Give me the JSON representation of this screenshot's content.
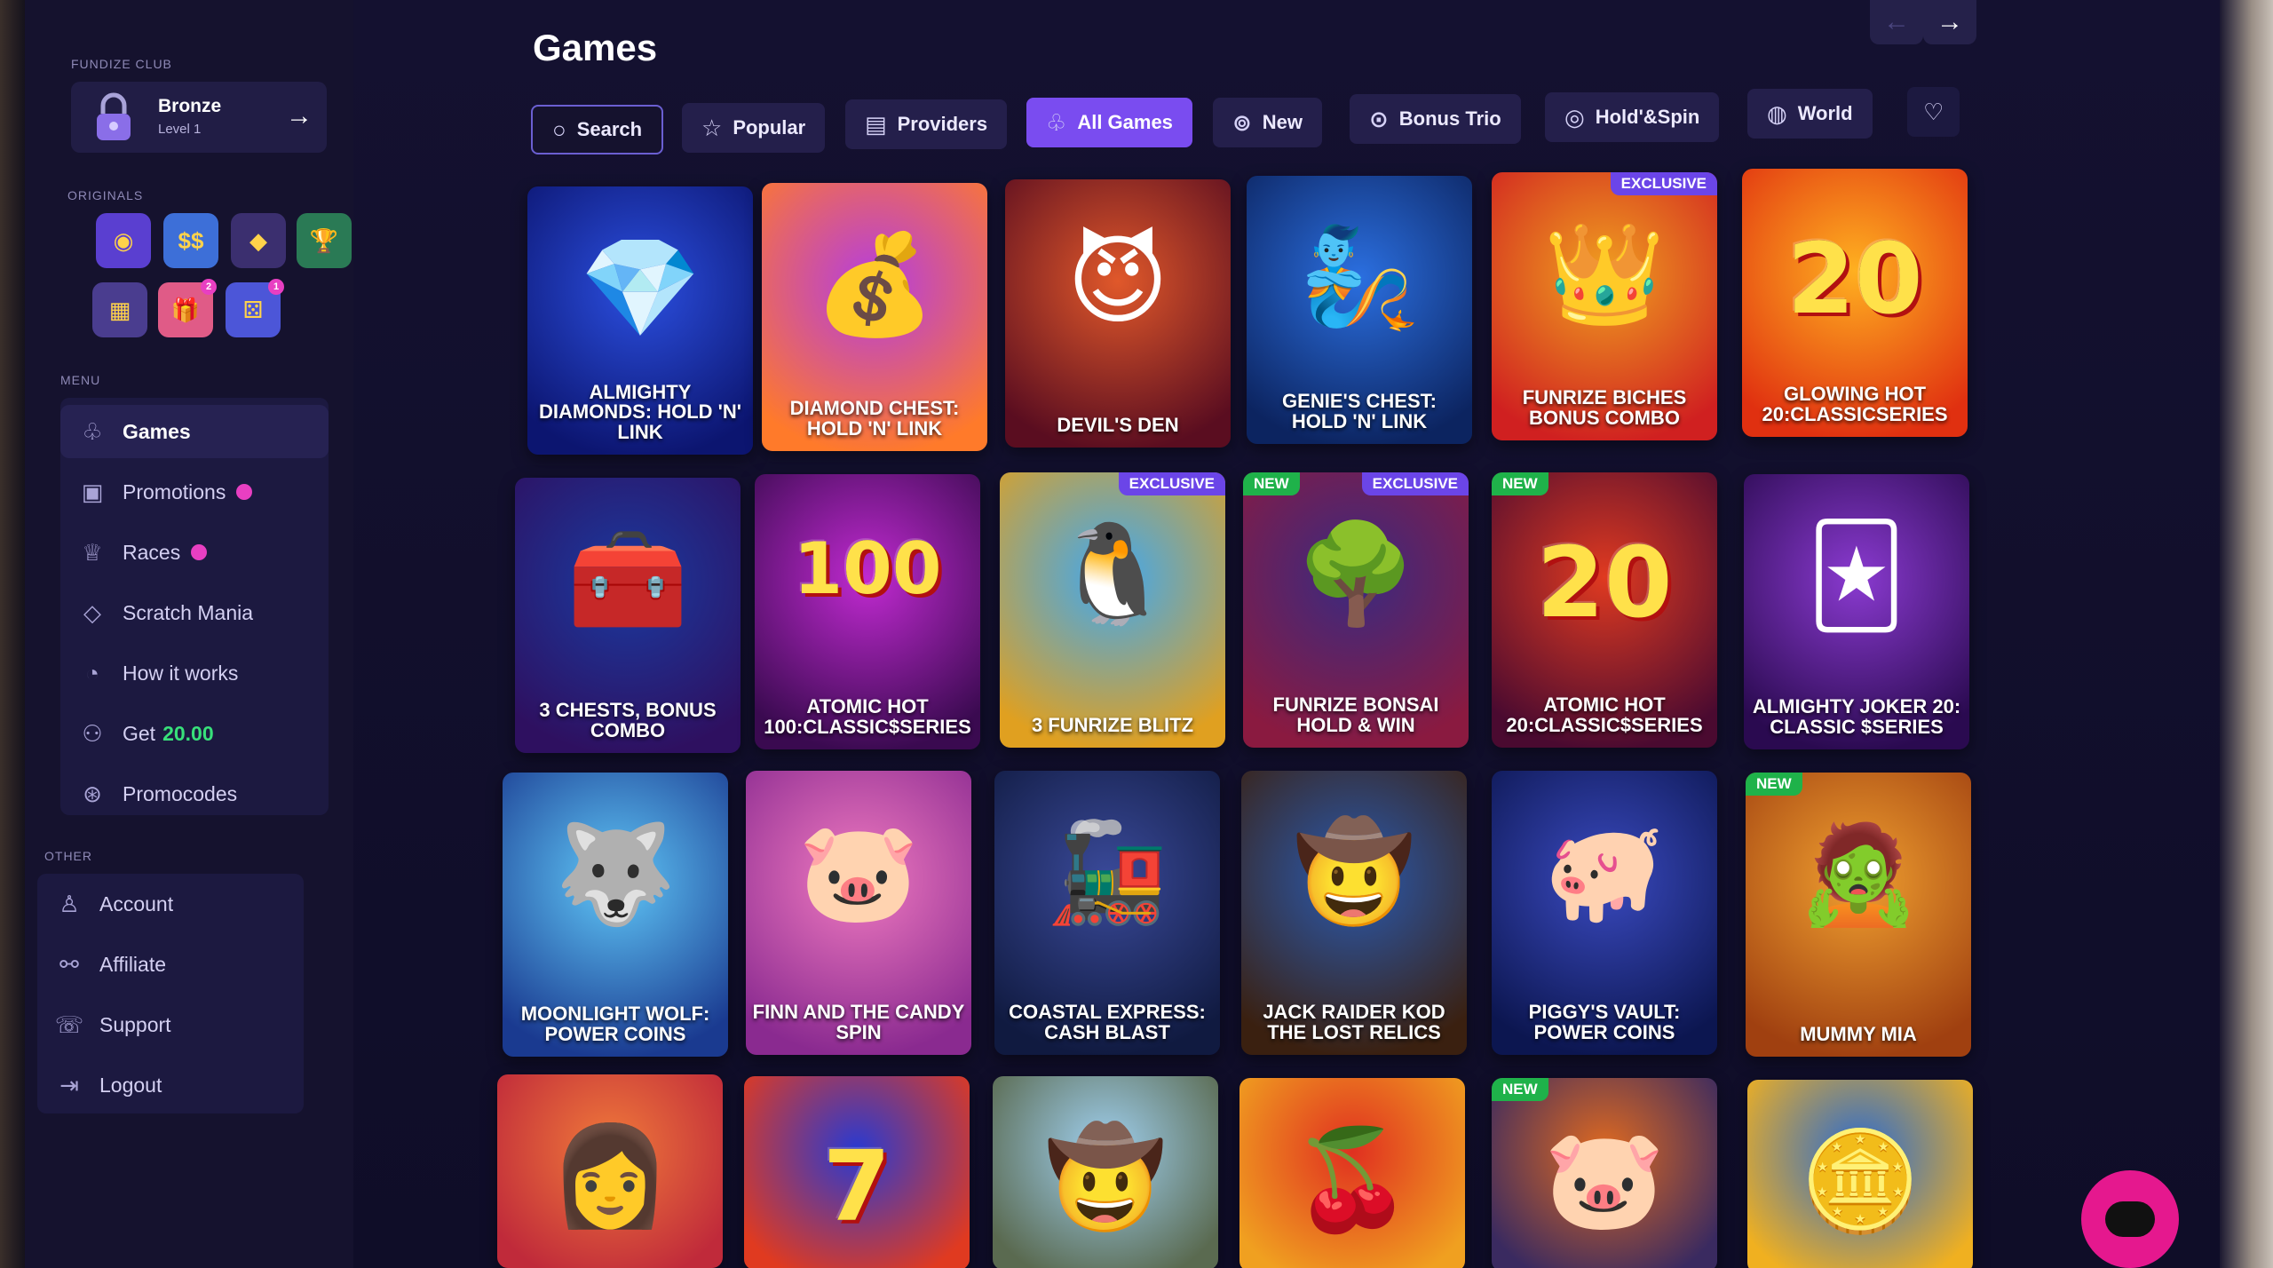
{
  "club": {
    "section": "FUNDIZE CLUB",
    "name": "Bronze",
    "level": "Level 1"
  },
  "originals": {
    "section": "ORIGINALS",
    "items": [
      {
        "icon": "wheel-icon",
        "color": "#5a3fd0",
        "glyph": "◉",
        "badge": ""
      },
      {
        "icon": "cash-stack-icon",
        "color": "#3d6fd8",
        "glyph": "$$",
        "badge": ""
      },
      {
        "icon": "gold-bar-icon",
        "color": "#3b2f6f",
        "glyph": "◆",
        "badge": ""
      },
      {
        "icon": "trophy-icon",
        "color": "#2a7a55",
        "glyph": "🏆",
        "badge": ""
      },
      {
        "icon": "grid-box-icon",
        "color": "#4a3d8f",
        "glyph": "▦",
        "badge": ""
      },
      {
        "icon": "gift-box-icon",
        "color": "#e05b87",
        "glyph": "🎁",
        "badge": "2"
      },
      {
        "icon": "dice-icon",
        "color": "#4c56d8",
        "glyph": "⚄",
        "badge": "1"
      }
    ]
  },
  "menu": {
    "section": "MENU",
    "items": [
      {
        "label": "Games",
        "icon": "games-icon",
        "glyph": "♧",
        "badge": false,
        "active": true
      },
      {
        "label": "Promotions",
        "icon": "gift-icon",
        "glyph": "▣",
        "badge": true
      },
      {
        "label": "Races",
        "icon": "trophy-outline-icon",
        "glyph": "♕",
        "badge": true
      },
      {
        "label": "Scratch Mania",
        "icon": "ticket-icon",
        "glyph": "◇",
        "badge": false
      },
      {
        "label": "How it works",
        "icon": "clock-icon",
        "glyph": "◔",
        "badge": false
      },
      {
        "label": "Get",
        "icon": "referral-icon",
        "glyph": "⚇",
        "badge": false,
        "amount": "20.00"
      },
      {
        "label": "Promocodes",
        "icon": "coupon-icon",
        "glyph": "⊛",
        "badge": false
      }
    ]
  },
  "other": {
    "section": "OTHER",
    "items": [
      {
        "label": "Account",
        "icon": "user-icon",
        "glyph": "♙"
      },
      {
        "label": "Affiliate",
        "icon": "handshake-icon",
        "glyph": "⚯"
      },
      {
        "label": "Support",
        "icon": "support-icon",
        "glyph": "☏"
      },
      {
        "label": "Logout",
        "icon": "logout-icon",
        "glyph": "⇥"
      }
    ]
  },
  "page": {
    "title": "Games"
  },
  "filters": [
    {
      "label": "Search",
      "icon": "search-icon",
      "glyph": "○",
      "kind": "search"
    },
    {
      "label": "Popular",
      "icon": "star-icon",
      "glyph": "☆"
    },
    {
      "label": "Providers",
      "icon": "providers-icon",
      "glyph": "▤"
    },
    {
      "label": "All Games",
      "icon": "all-games-icon",
      "glyph": "♧",
      "kind": "active"
    },
    {
      "label": "New",
      "icon": "new-icon",
      "glyph": "⊚"
    },
    {
      "label": "Bonus Trio",
      "icon": "bonus-trio-icon",
      "glyph": "⊙"
    },
    {
      "label": "Hold'&Spin",
      "icon": "hold-spin-icon",
      "glyph": "◎"
    },
    {
      "label": "World",
      "icon": "globe-icon",
      "glyph": "◍"
    },
    {
      "label": "",
      "icon": "heart-icon",
      "glyph": "♡"
    }
  ],
  "games": [
    [
      {
        "title": "ALMIGHTY DIAMONDS: HOLD 'N' LINK",
        "bg": [
          "#2b4fe0",
          "#0c1570"
        ],
        "glyph": "💎",
        "tag": ""
      },
      {
        "title": "DIAMOND CHEST: HOLD 'N' LINK",
        "bg": [
          "#b43de0",
          "#ff7a2a"
        ],
        "glyph": "💰",
        "tag": ""
      },
      {
        "title": "DEVIL'S DEN",
        "bg": [
          "#e0582a",
          "#5a0d20"
        ],
        "glyph": "😈",
        "tag": ""
      },
      {
        "title": "GENIE'S CHEST: HOLD 'N' LINK",
        "bg": [
          "#2b6fe0",
          "#0c2460"
        ],
        "glyph": "🧞",
        "tag": ""
      },
      {
        "title": "FUNRIZE BICHES BONUS COMBO",
        "bg": [
          "#f0a020",
          "#d02020"
        ],
        "glyph": "👑",
        "tag": "EXCLUSIVE"
      },
      {
        "title": "GLOWING HOT 20:CLASSICSERIES",
        "bg": [
          "#ffb020",
          "#e03010"
        ],
        "glyph": "20",
        "tag": ""
      }
    ],
    [
      {
        "title": "3 CHESTS, BONUS COMBO",
        "bg": [
          "#1a3aa0",
          "#2e1060"
        ],
        "glyph": "🧰",
        "tag": ""
      },
      {
        "title": "ATOMIC HOT 100:CLASSIC$SERIES",
        "bg": [
          "#c02ad0",
          "#3a0a50"
        ],
        "glyph": "100",
        "tag": ""
      },
      {
        "title": "3 FUNRIZE BLITZ",
        "bg": [
          "#40a8f0",
          "#e0a020"
        ],
        "glyph": "🐧",
        "tag": "EXCLUSIVE"
      },
      {
        "title": "FUNRIZE BONSAI HOLD & WIN",
        "bg": [
          "#3a2a80",
          "#8a1a40"
        ],
        "glyph": "🌳",
        "tag": "NEW+EXCLUSIVE"
      },
      {
        "title": "ATOMIC HOT 20:CLASSIC$SERIES",
        "bg": [
          "#e03a20",
          "#4a0a30"
        ],
        "glyph": "20",
        "tag": "NEW"
      },
      {
        "title": "ALMIGHTY JOKER 20: CLASSIC $SERIES",
        "bg": [
          "#8a3ad0",
          "#2a0a50"
        ],
        "glyph": "🃏",
        "tag": ""
      }
    ],
    [
      {
        "title": "MOONLIGHT WOLF: POWER COINS",
        "bg": [
          "#60c8f8",
          "#1a3a90"
        ],
        "glyph": "🐺",
        "tag": ""
      },
      {
        "title": "FINN AND THE CANDY SPIN",
        "bg": [
          "#f07ac0",
          "#8a2a90"
        ],
        "glyph": "🐷",
        "tag": ""
      },
      {
        "title": "COASTAL EXPRESS: CASH BLAST",
        "bg": [
          "#3a4a9a",
          "#101a40"
        ],
        "glyph": "🚂",
        "tag": ""
      },
      {
        "title": "JACK RAIDER KOD THE LOST RELICS",
        "bg": [
          "#2a5ab0",
          "#3a2010"
        ],
        "glyph": "🤠",
        "tag": ""
      },
      {
        "title": "PIGGY'S VAULT: POWER COINS",
        "bg": [
          "#3a4ac0",
          "#0c1650"
        ],
        "glyph": "🐖",
        "tag": ""
      },
      {
        "title": "MUMMY MIA",
        "bg": [
          "#f0a030",
          "#a04010"
        ],
        "glyph": "🧟",
        "tag": "NEW"
      }
    ],
    [
      {
        "title": "",
        "bg": [
          "#f07a3a",
          "#c02a3a"
        ],
        "glyph": "👩",
        "tag": ""
      },
      {
        "title": "",
        "bg": [
          "#2a3ad0",
          "#e03a20"
        ],
        "glyph": "7",
        "tag": ""
      },
      {
        "title": "",
        "bg": [
          "#a0d0f0",
          "#5a6a50"
        ],
        "glyph": "🤠",
        "tag": ""
      },
      {
        "title": "",
        "bg": [
          "#e03020",
          "#f0a020"
        ],
        "glyph": "🍒",
        "tag": ""
      },
      {
        "title": "",
        "bg": [
          "#e06a20",
          "#3a2a60"
        ],
        "glyph": "🐷",
        "tag": "NEW"
      },
      {
        "title": "",
        "bg": [
          "#2a6ad0",
          "#f0b020"
        ],
        "glyph": "🪙",
        "tag": ""
      }
    ]
  ]
}
